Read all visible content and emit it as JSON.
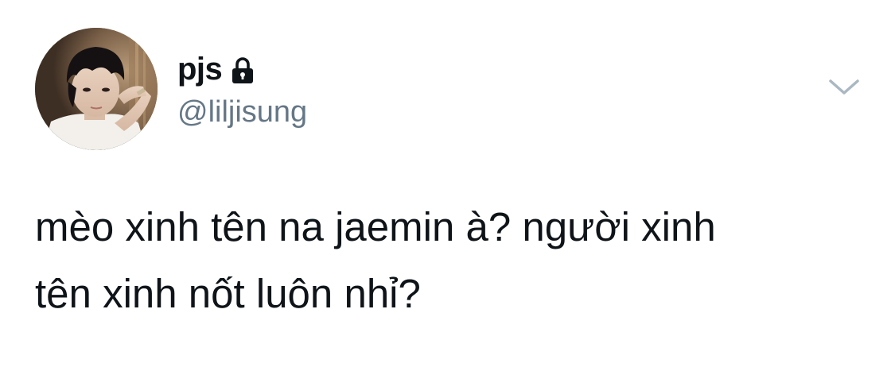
{
  "author": {
    "display_name": "pjs",
    "handle": "@liljisung",
    "protected": true,
    "avatar_icon": "profile-photo",
    "lock_icon": "lock-icon"
  },
  "menu": {
    "icon": "chevron-down-icon"
  },
  "tweet": {
    "line1": "mèo xinh tên na jaemin à? người xinh",
    "line2": "tên xinh nốt luôn nhỉ?"
  },
  "colors": {
    "text": "#0f1419",
    "secondary": "#657786",
    "chevron": "#aab8c2",
    "background": "#ffffff"
  }
}
